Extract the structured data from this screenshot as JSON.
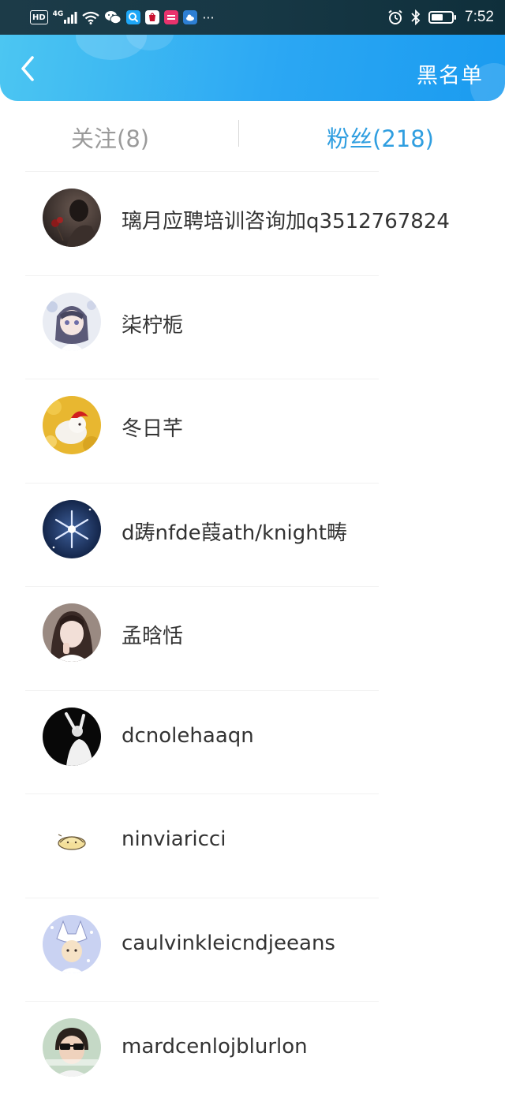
{
  "status_bar": {
    "hd": "HD",
    "network": "4G",
    "app_icons": [
      "search-app-icon",
      "huawei-store-icon",
      "shopping-app-icon",
      "cloud-app-icon"
    ],
    "more": "···",
    "time": "7:52"
  },
  "header": {
    "back_icon": "chevron-left-icon",
    "blacklist_label": "黑名单"
  },
  "tabs": {
    "following": "关注(8)",
    "fans": "粉丝(218)",
    "active": "fans"
  },
  "colors": {
    "header_start": "#4cc6f2",
    "header_end": "#1a9bf0",
    "active_tab": "#2f9ee0",
    "inactive_tab": "#9a9a9a",
    "name_text": "#333333"
  },
  "fans": [
    {
      "name": "璃月应聘培训咨询加q3512767824",
      "avatar": "dark-rose-photo"
    },
    {
      "name": "柒柠栀",
      "avatar": "anime-girl"
    },
    {
      "name": "冬日芊",
      "avatar": "white-rabbit-red-hat"
    },
    {
      "name": "d踌nfde葭ath/knight畴",
      "avatar": "snowflake-dark-blue"
    },
    {
      "name": "孟晗恬",
      "avatar": "girl-selfie"
    },
    {
      "name": "dcnolehaaqn",
      "avatar": "black-white-figure"
    },
    {
      "name": "ninviaricci",
      "avatar": "cartoon-bun"
    },
    {
      "name": "caulvinkleicndjeeans",
      "avatar": "cartoon-fox-hat"
    },
    {
      "name": "mardcenlojblurlon",
      "avatar": "boy-sunglasses"
    }
  ]
}
